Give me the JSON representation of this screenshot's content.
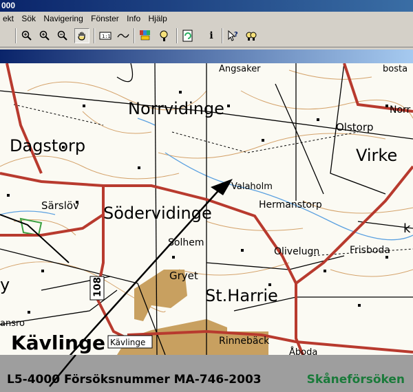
{
  "window": {
    "title": "000"
  },
  "menu": [
    "ekt",
    "Sök",
    "Navigering",
    "Fönster",
    "Info",
    "Hjälp"
  ],
  "toolbar": {
    "icons": [
      "zoom-in-icon",
      "zoom-in-alt-icon",
      "zoom-out-icon",
      "pan-hand-icon",
      "scale-icon",
      "measure-icon",
      "layers-icon",
      "search-icon",
      "refresh-icon",
      "info-icon",
      "help-icon",
      "find-icon"
    ],
    "info_glyph": "i"
  },
  "map": {
    "places": {
      "angsaker": "Angsaker",
      "bosta": "bosta",
      "norrvidinge": "Norrvidinge",
      "norr": "Norr",
      "olstorp": "Olstorp",
      "dagstorp": "Dagstorp",
      "virke": "Virke",
      "valaholm": "Valaholm",
      "hermanstorp": "Hermanstorp",
      "sarslov": "Särslöv",
      "sodervidinge": "Södervidinge",
      "solhem": "Solhem",
      "olivelugn": "Olivelugn",
      "frisboda": "Frisboda",
      "gryet": "Gryet",
      "st_harrie": "St.Harrie",
      "kavlinge_big": "Kävlinge",
      "kavlinge_box": "Kävlinge",
      "rinnebacks": "Rinnebäck",
      "abada": "Åboda",
      "hansro": "ansro",
      "y": "y",
      "road_108": "108",
      "right_edge_k": "k"
    }
  },
  "footer": {
    "left": "L5-4000  Försöksnummer MA-746-2003",
    "right": "Skåneförsöken"
  },
  "colors": {
    "road": "#c0392b",
    "urban": "#c8a060",
    "water": "#5aa0e0",
    "contour": "#d4a26a",
    "footer_green": "#1a7a3a"
  }
}
